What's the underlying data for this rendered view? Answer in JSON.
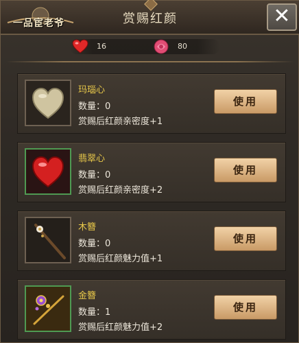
{
  "header": {
    "logo_text": "一品宦老爷",
    "title": "赏赐红颜",
    "close_label": "✕"
  },
  "resources": {
    "hearts": {
      "icon": "heart-icon",
      "value": "16"
    },
    "roses": {
      "icon": "rose-icon",
      "value": "80"
    }
  },
  "items": [
    {
      "name": "玛瑙心",
      "count_label": "数量：",
      "count": "0",
      "desc": "赏赐后红颜亲密度+1",
      "button": "使用",
      "icon": "agate-heart-icon",
      "frame": "gray"
    },
    {
      "name": "翡翠心",
      "count_label": "数量：",
      "count": "0",
      "desc": "赏赐后红颜亲密度+2",
      "button": "使用",
      "icon": "jade-heart-icon",
      "frame": "green"
    },
    {
      "name": "木簪",
      "count_label": "数量：",
      "count": "0",
      "desc": "赏赐后红颜魅力值+1",
      "button": "使用",
      "icon": "wooden-hairpin-icon",
      "frame": "gray"
    },
    {
      "name": "金簪",
      "count_label": "数量：",
      "count": "1",
      "desc": "赏赐后红颜魅力值+2",
      "button": "使用",
      "icon": "golden-hairpin-icon",
      "frame": "green"
    }
  ]
}
